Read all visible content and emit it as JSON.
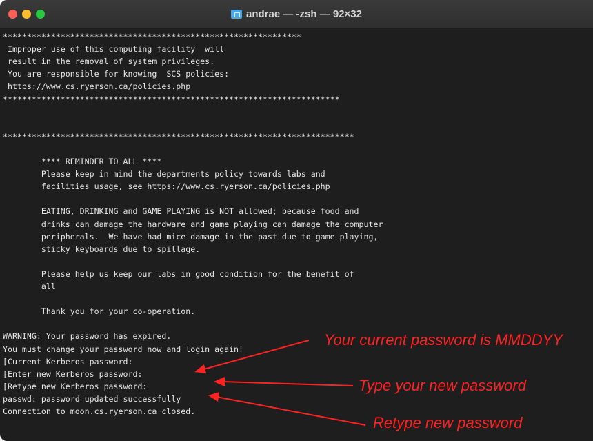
{
  "window": {
    "title": "andrae — -zsh — 92×32",
    "title_icon": "folder-icon"
  },
  "terminal": {
    "lines": [
      "**************************************************************",
      " Improper use of this computing facility  will",
      " result in the removal of system privileges.",
      " You are responsible for knowing  SCS policies:",
      " https://www.cs.ryerson.ca/policies.php",
      "**********************************************************************",
      "",
      "",
      "*************************************************************************",
      "",
      "        **** REMINDER TO ALL ****",
      "        Please keep in mind the departments policy towards labs and",
      "        facilities usage, see https://www.cs.ryerson.ca/policies.php",
      "",
      "        EATING, DRINKING and GAME PLAYING is NOT allowed; because food and",
      "        drinks can damage the hardware and game playing can damage the computer",
      "        peripherals.  We have had mice damage in the past due to game playing,",
      "        sticky keyboards due to spillage.",
      "",
      "        Please help us keep our labs in good condition for the benefit of",
      "        all",
      "",
      "        Thank you for your co-operation.",
      "",
      "WARNING: Your password has expired.",
      "You must change your password now and login again!",
      "[Current Kerberos password:",
      "[Enter new Kerberos password:",
      "[Retype new Kerberos password:",
      "passwd: password updated successfully",
      "Connection to moon.cs.ryerson.ca closed."
    ]
  },
  "annotations": {
    "current_password": "Your current password is MMDDYY",
    "new_password": "Type your new password",
    "retype_password": "Retype new password",
    "color": "#ff2222"
  }
}
